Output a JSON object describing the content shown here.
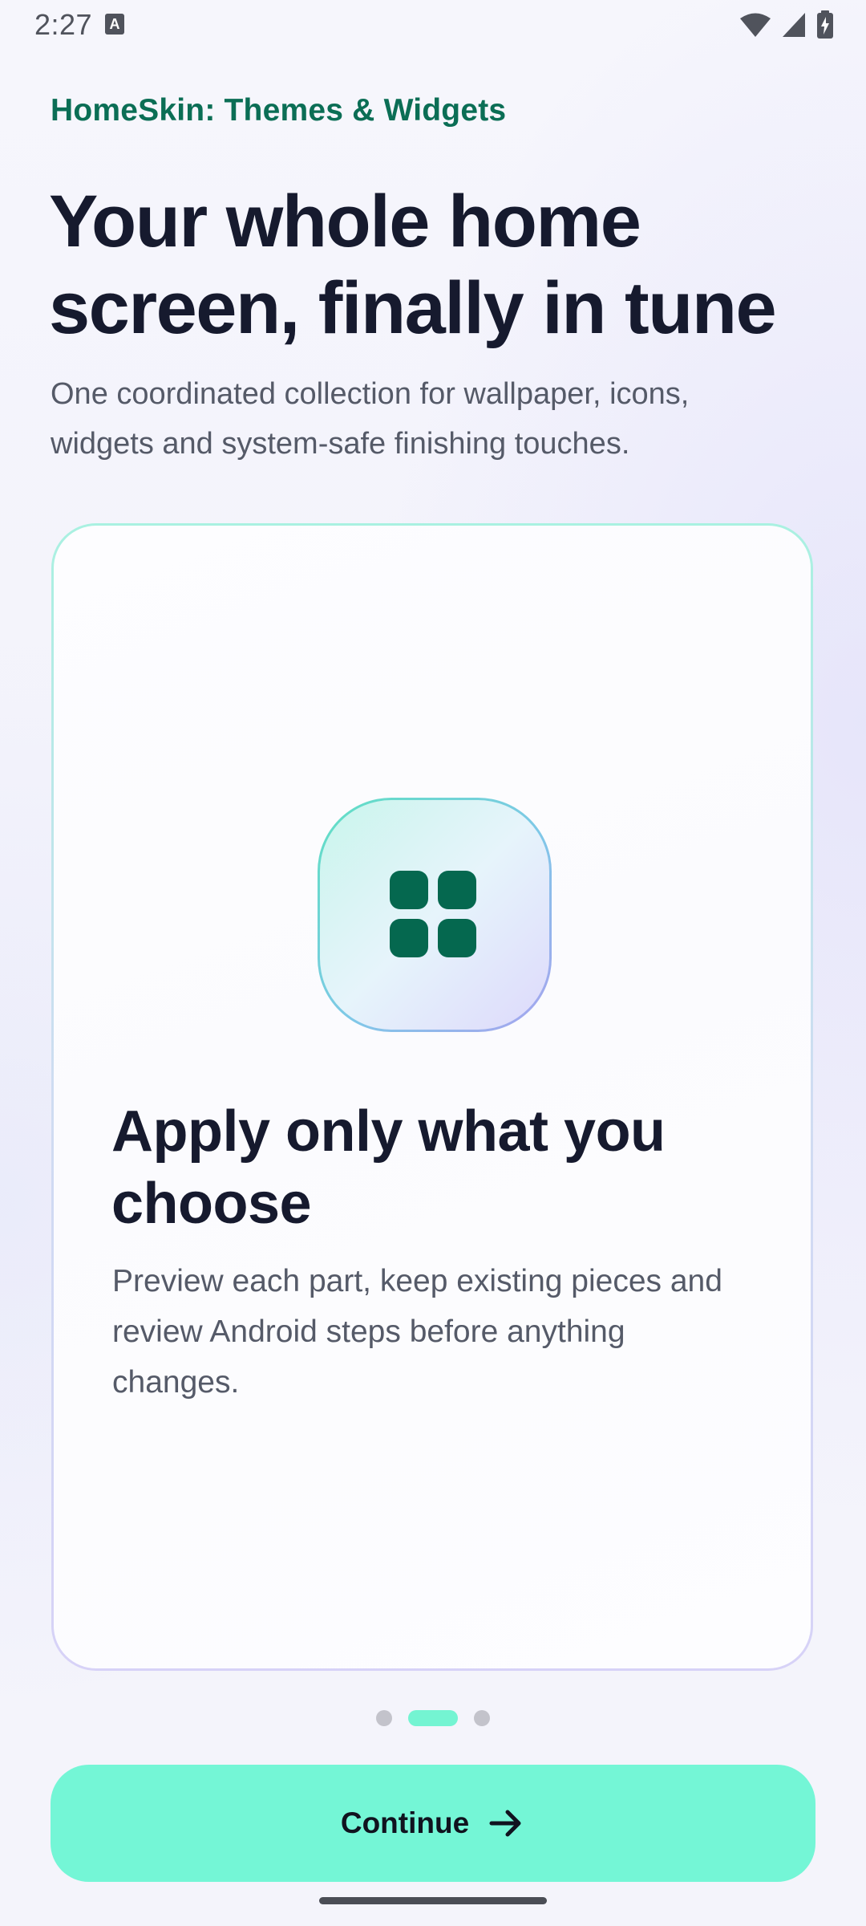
{
  "status_bar": {
    "time": "2:27",
    "notification_icon_letter": "A",
    "icons": [
      "wifi-icon",
      "cell-signal-icon",
      "battery-charging-icon"
    ]
  },
  "header": {
    "app_name": "HomeSkin: Themes & Widgets",
    "headline": "Your whole home screen, finally in tune",
    "subhead": "One coordinated collection for wallpaper, icons, widgets and system-safe finishing touches."
  },
  "feature_card": {
    "icon": "grid-icon",
    "title": "Apply only what you choose",
    "description": "Preview each part, keep existing pieces and review Android steps before anything changes."
  },
  "pager": {
    "total_pages": 3,
    "current_page": 2
  },
  "continue_button": {
    "label": "Continue",
    "icon": "arrow-right-icon"
  },
  "colors": {
    "accent_green": "#0b6e55",
    "button_mint": "#74f6d6",
    "headline_text": "#161a2e",
    "body_text": "#555a68"
  }
}
